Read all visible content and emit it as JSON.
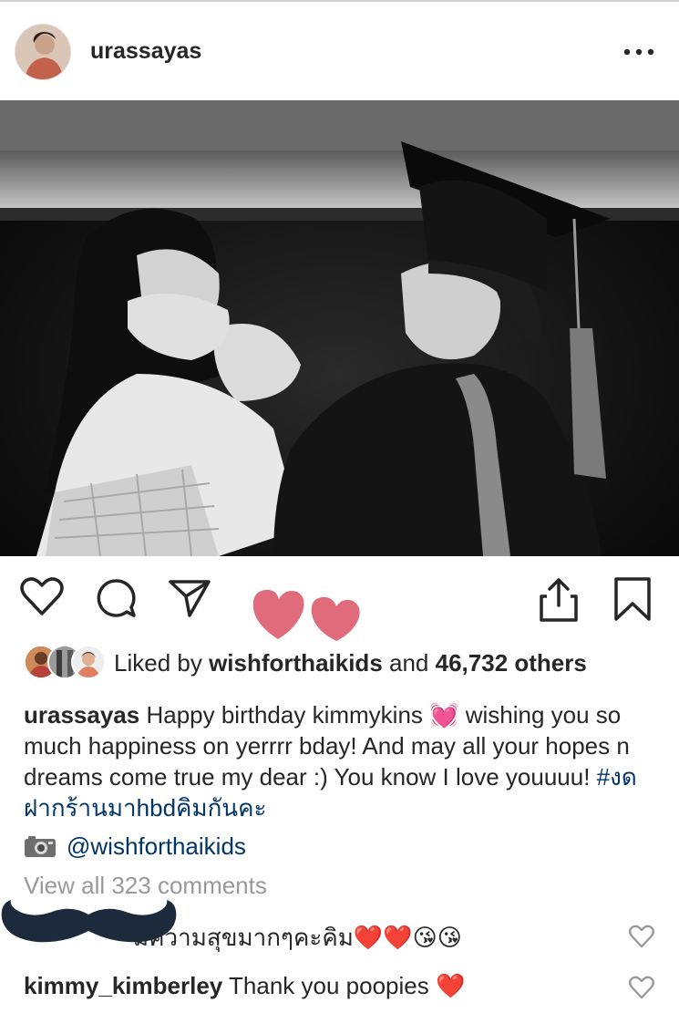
{
  "post": {
    "username": "urassayas",
    "more_icon": "more-dots-icon"
  },
  "actions": {
    "like_icon": "heart-outline-icon",
    "comment_icon": "comment-bubble-icon",
    "share_icon": "paper-plane-icon",
    "upload_icon": "share-upload-icon",
    "save_icon": "bookmark-icon",
    "sticker_color": "#e06b7a"
  },
  "likes": {
    "prefix": "Liked by",
    "user": "wishforthaikids",
    "middle": "and",
    "count": "46,732 others"
  },
  "caption": {
    "username": "urassayas",
    "text": "Happy birthday kimmykins 💓 wishing you so much happiness on yerrrr bday! And may all your hopes n dreams come true my dear :) You know I love youuuu!",
    "hashtag": "#งดฝากร้านมาhbdคิมกันคะ"
  },
  "tag": {
    "camera_icon": "camera-icon",
    "user": "@wishforthaikids"
  },
  "view_all": "View all 323 comments",
  "comments": [
    {
      "username": "",
      "text": "มีความสุขมากๆคะคิม❤️❤️😘😘"
    },
    {
      "username": "kimmy_kimberley",
      "text": "Thank you poopies ❤️"
    }
  ],
  "colors": {
    "text": "#262626",
    "link": "#003569",
    "muted": "#999999"
  }
}
